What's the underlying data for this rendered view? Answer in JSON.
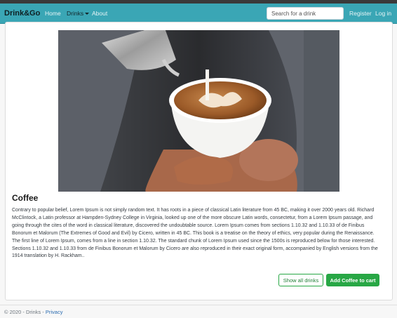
{
  "navbar": {
    "brand": "Drink&Go",
    "links": {
      "home": "Home",
      "drinks": "Drinks",
      "about": "About",
      "register": "Register",
      "login": "Log in"
    },
    "search_placeholder": "Search for a drink"
  },
  "product": {
    "image_alt": "Coffee",
    "title": "Coffee",
    "description": "Contrary to popular belief, Lorem Ipsum is not simply random text. It has roots in a piece of classical Latin literature from 45 BC, making it over 2000 years old. Richard McClintock, a Latin professor at Hampden-Sydney College in Virginia, looked up one of the more obscure Latin words, consectetur, from a Lorem Ipsum passage, and going through the cites of the word in classical literature, discovered the undoubtable source. Lorem Ipsum comes from sections 1.10.32 and 1.10.33 of de Finibus Bonorum et Malorum (The Extremes of Good and Evil) by Cicero, written in 45 BC. This book is a treatise on the theory of ethics, very popular during the Renaissance. The first line of Lorem Ipsum, comes from a line in section 1.10.32. The standard chunk of Lorem Ipsum used since the 1500s is reproduced below for those interested. Sections 1.10.32 and 1.10.33 from de Finibus Bonorum et Malorum by Cicero are also reproduced in their exact original form, accompanied by English versions from the 1914 translation by H. Rackham..",
    "show_all_label": "Show all drinks",
    "add_to_cart_label": "Add Coffee to cart"
  },
  "footer": {
    "copyright": "© 2020 - Drinks - ",
    "privacy": "Privacy"
  },
  "colors": {
    "navbar": "#3aa6b5",
    "accent": "#28a745",
    "link": "#2b6cb0"
  }
}
